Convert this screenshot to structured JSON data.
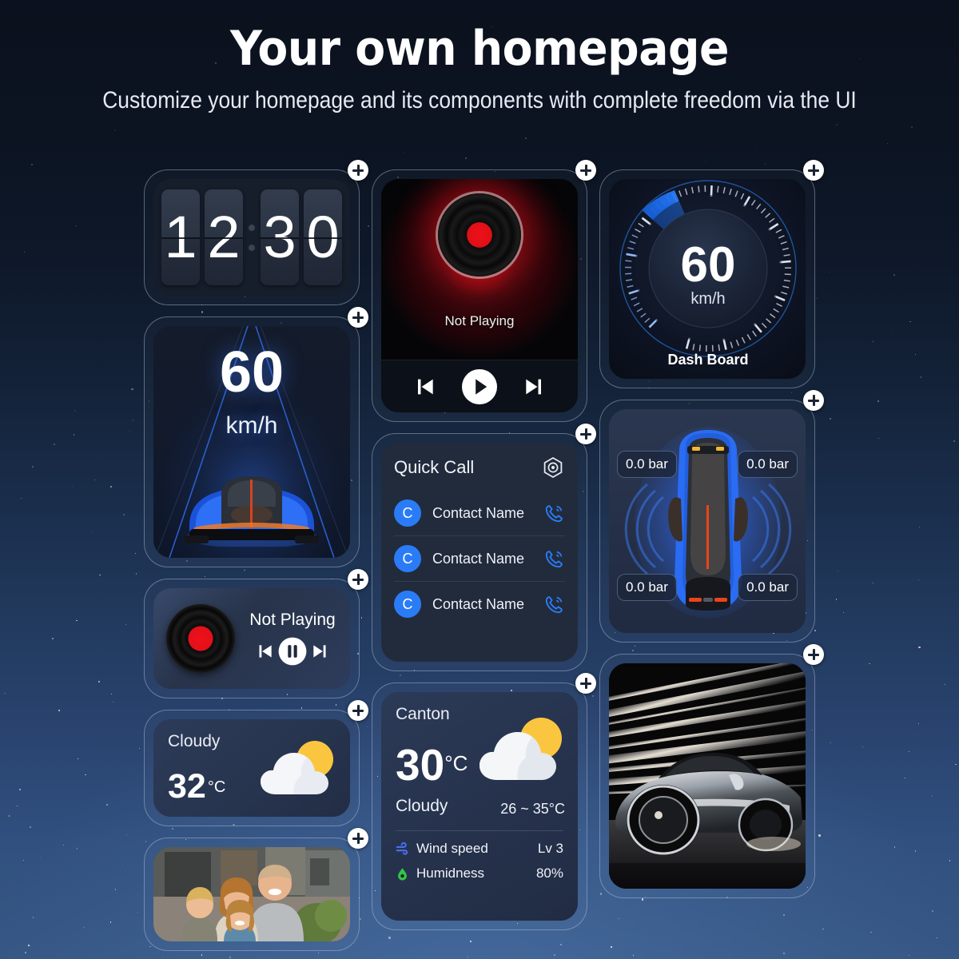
{
  "header": {
    "title": "Your own homepage",
    "subtitle": "Customize your homepage and its components with complete freedom via the UI"
  },
  "colors": {
    "accent_blue": "#2a7cf6",
    "gauge_blue": "#1d6ff0",
    "record_red": "#ee1018",
    "sun_yellow": "#fcc949",
    "humidity_green": "#35c44a",
    "background_top": "#0b111d",
    "background_bottom": "#365784"
  },
  "add_button_label": "+",
  "widgets": {
    "clock": {
      "name": "Flip Clock",
      "digits": [
        "1",
        "2",
        "3",
        "0"
      ],
      "time": "12:30"
    },
    "music_player_large": {
      "name": "Music Player",
      "status": "Not Playing",
      "controls": [
        "previous",
        "play",
        "next"
      ]
    },
    "dashboard": {
      "name": "Dash Board",
      "value": "60",
      "unit": "km/h",
      "label": "Dash Board",
      "gauge_percent": 22
    },
    "speedometer": {
      "name": "Speedometer",
      "value": "60",
      "unit": "km/h"
    },
    "quick_call": {
      "title": "Quick Call",
      "settings_icon": "hexagon-gear-icon",
      "contacts": [
        {
          "avatar": "C",
          "name": "Contact Name",
          "action_icon": "phone-icon"
        },
        {
          "avatar": "C",
          "name": "Contact Name",
          "action_icon": "phone-icon"
        },
        {
          "avatar": "C",
          "name": "Contact Name",
          "action_icon": "phone-icon"
        }
      ]
    },
    "tire_pressure": {
      "name": "Tire Pressure",
      "front_left": "0.0 bar",
      "front_right": "0.0 bar",
      "rear_left": "0.0 bar",
      "rear_right": "0.0 bar"
    },
    "music_player_mini": {
      "name": "Mini Music Player",
      "status": "Not Playing",
      "controls": [
        "previous",
        "pause",
        "next"
      ]
    },
    "weather_small": {
      "condition": "Cloudy",
      "temperature": "32",
      "unit": "°C",
      "icon": "sun-behind-cloud-icon"
    },
    "weather_large": {
      "city": "Canton",
      "temperature": "30",
      "unit": "°C",
      "condition": "Cloudy",
      "range": "26 ~ 35°C",
      "icon": "sun-behind-cloud-icon",
      "details": [
        {
          "icon": "wind-icon",
          "label": "Wind speed",
          "value": "Lv 3"
        },
        {
          "icon": "humidity-icon",
          "label": "Humidness",
          "value": "80%"
        }
      ]
    },
    "photo_car": {
      "name": "Car Photo",
      "alt": "silver sports car with light streaks"
    },
    "photo_family": {
      "name": "Family Photo",
      "alt": "family of four outdoors"
    }
  }
}
